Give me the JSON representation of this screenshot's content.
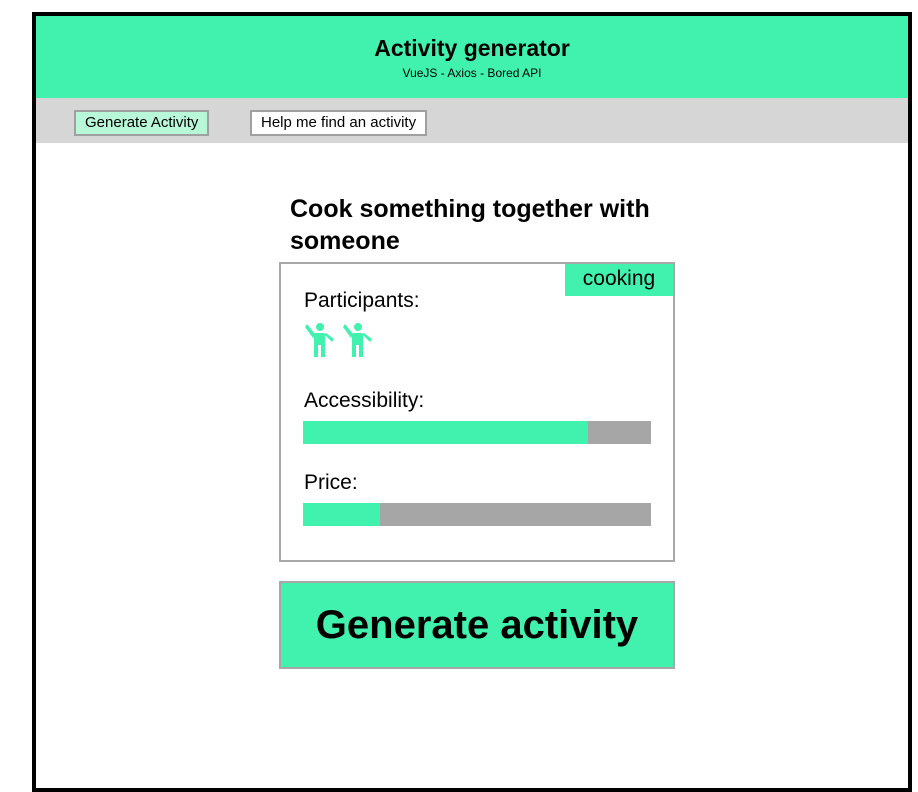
{
  "header": {
    "title": "Activity generator",
    "subtitle": "VueJS - Axios - Bored API"
  },
  "nav": {
    "items": [
      {
        "label": "Generate Activity",
        "active": true
      },
      {
        "label": "Help me find an activity",
        "active": false
      }
    ]
  },
  "activity": {
    "title": "Cook something together with someone",
    "type": "cooking",
    "participants_label": "Participants:",
    "participants": 2,
    "participant_icon": "person-waving-icon",
    "accessibility_label": "Accessibility:",
    "accessibility": 0.82,
    "price_label": "Price:",
    "price": 0.22
  },
  "generate_button": {
    "label": "Generate activity"
  },
  "colors": {
    "accent": "#41f2ae",
    "nav_bg": "#d6d6d6",
    "active_nav": "#b8f7d8",
    "meter_track": "#a6a6a6",
    "frame_border": "#000000"
  }
}
